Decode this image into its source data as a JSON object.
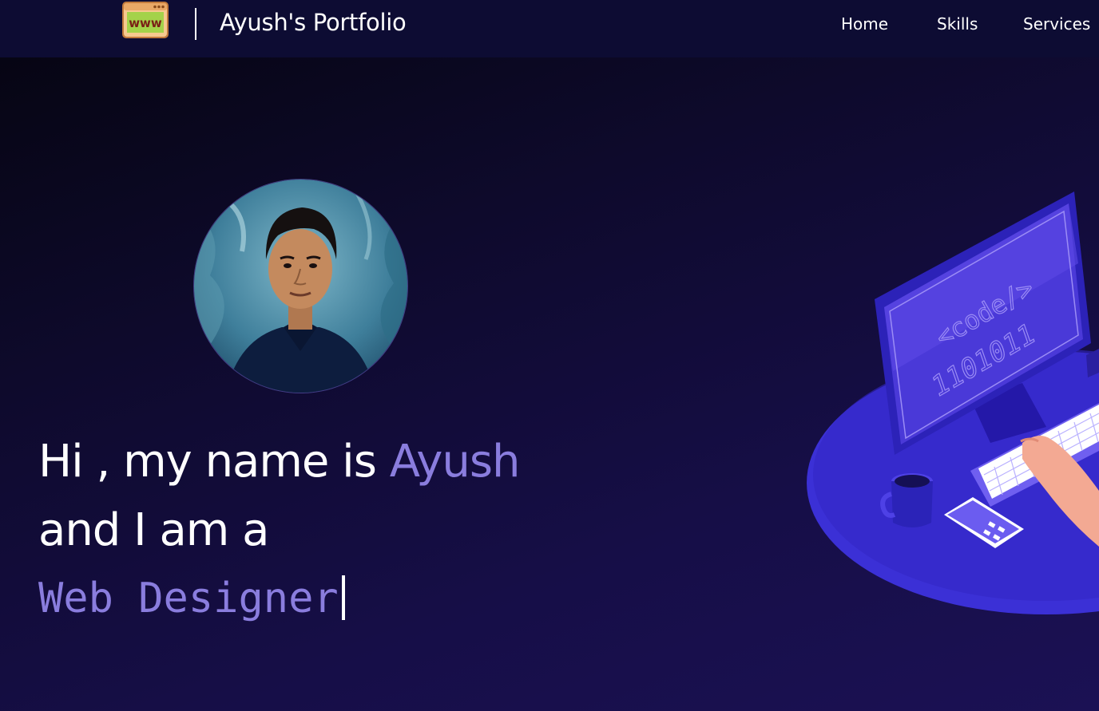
{
  "header": {
    "logo_icon": "www-browser-icon",
    "brand": "Ayush's Portfolio",
    "nav": {
      "home": "Home",
      "skills": "Skills",
      "services": "Services"
    }
  },
  "hero": {
    "greeting": "Hi , my name is ",
    "name": "Ayush",
    "line2": "and I am a",
    "typed_role": "Web Designer",
    "profile_photo": "profile-photo",
    "illustration": {
      "screen_text_1": "<code/>",
      "screen_text_2": "1101011"
    }
  },
  "colors": {
    "navbar_bg": "#0d0c33",
    "accent": "#8a7dde",
    "text": "#ffffff",
    "platform": "#3a2fd0"
  }
}
